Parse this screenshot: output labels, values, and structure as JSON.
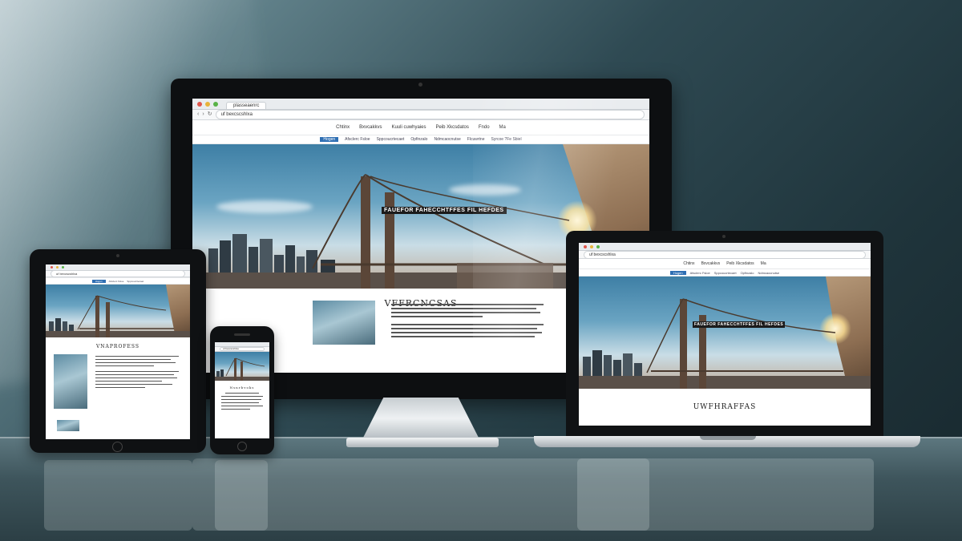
{
  "browser": {
    "tab_title": "plasseaenrc",
    "url": "uf bexcscshlxa",
    "back_glyph": "‹",
    "forward_glyph": "›",
    "reload_glyph": "↻"
  },
  "site": {
    "nav": [
      "Chtinx",
      "Bxvcakkvs",
      "Kuuli cuwhyaies",
      "Peib Xkcsdatos",
      "Fndo",
      "Ma"
    ],
    "subnav": [
      "Hogen",
      "Afsclerc Fsloe",
      "Sppcoucrtecaet",
      "Opfinzalo",
      "Ndmcaocnutse",
      "Flcuwrtne",
      "Syrcoe ?Fe Sbiel"
    ],
    "hero_headline": "FAUEFOR FAHECCHTFFES FIL HEFDES",
    "content_title": "VFFRCNCSAS",
    "laptop_content_title": "UWFHRAFFAS",
    "tablet_content_title": "VNAPROFESS",
    "phone_content_title": "Nsnrbvoks"
  },
  "icons": [
    "camera-icon",
    "browser-close-dot-icon",
    "browser-minimize-dot-icon",
    "browser-maximize-dot-icon",
    "back-arrow-icon",
    "forward-arrow-icon",
    "reload-icon",
    "home-button-icon"
  ],
  "colors": {
    "nav_active": "#2f6fb3",
    "headline_bg": "#1b1b1b",
    "device_bezel": "#0d0f11"
  }
}
